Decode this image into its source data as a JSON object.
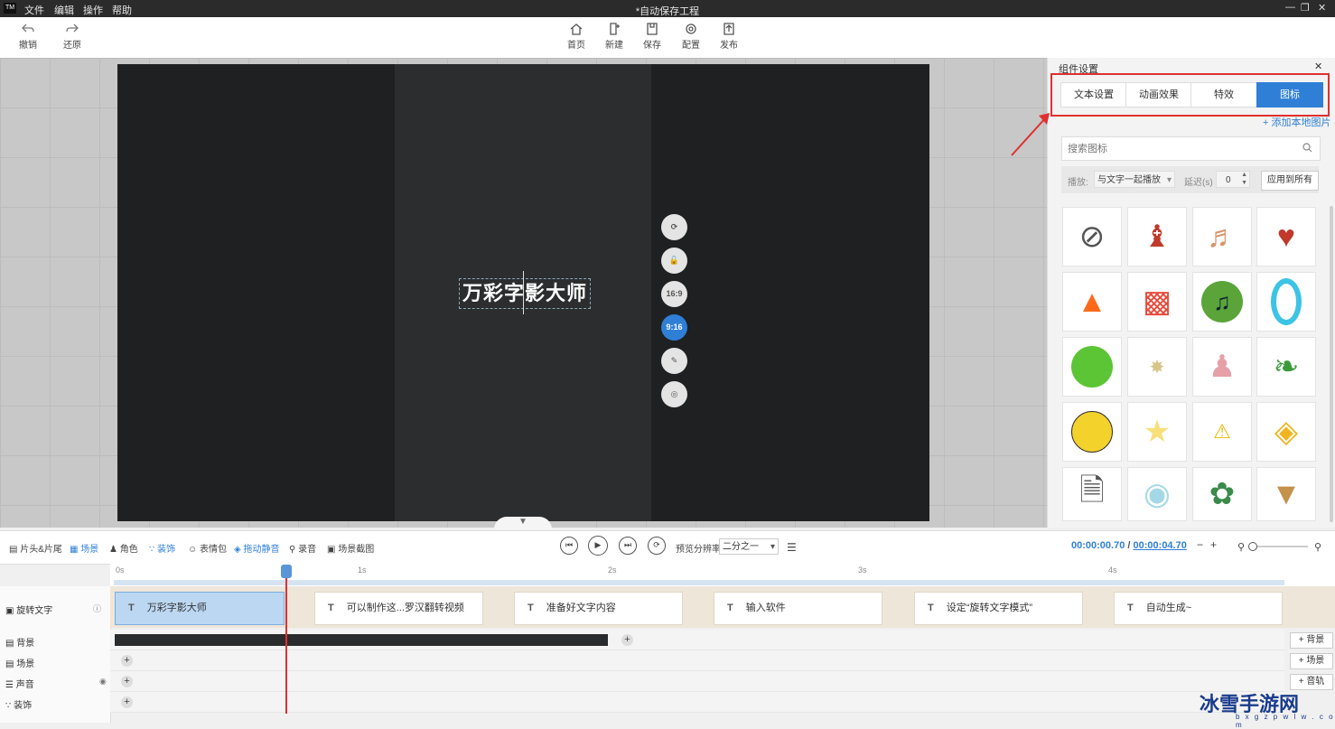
{
  "app": {
    "logo": "TM",
    "menu": [
      "文件",
      "编辑",
      "操作",
      "帮助"
    ],
    "title": "*自动保存工程",
    "window_controls": [
      "minimize",
      "restore",
      "close"
    ]
  },
  "toolbar": {
    "undo": "撤销",
    "redo": "还原",
    "home": "首页",
    "new": "新建",
    "save": "保存",
    "config": "配置",
    "publish": "发布"
  },
  "canvas": {
    "title_text": "万彩字影大师",
    "side_buttons": [
      {
        "name": "rotate-icon",
        "label": ""
      },
      {
        "name": "lock-icon",
        "label": ""
      },
      {
        "name": "ratio-16-9",
        "label": "16:9"
      },
      {
        "name": "ratio-9-16",
        "label": "9:16",
        "active": true
      },
      {
        "name": "edit-icon",
        "label": ""
      },
      {
        "name": "settings-icon",
        "label": ""
      }
    ]
  },
  "panel": {
    "title": "组件设置",
    "tabs": [
      {
        "label": "文本设置",
        "active": false
      },
      {
        "label": "动画效果",
        "active": false
      },
      {
        "label": "特效",
        "active": false
      },
      {
        "label": "图标",
        "active": true
      }
    ],
    "add_local": "添加本地图片",
    "search_placeholder": "搜索图标",
    "play_label": "播放:",
    "play_value": "与文字一起播放",
    "delay_label": "延迟(s)",
    "delay_value": "0",
    "apply_all": "应用到所有",
    "icons": [
      "no-icon",
      "scarecrow-icon",
      "dancer-icon",
      "playing-cards-icon",
      "fire-icon",
      "popcorn-icon",
      "music-note-icon",
      "blue-ring-icon",
      "green-apple-icon",
      "sparkle-icon",
      "girl-icon",
      "leaf-icon",
      "sunglasses-emoji-icon",
      "star-icon",
      "warning-sign-icon",
      "necklace-icon",
      "document-icon",
      "macaron-icon",
      "gift-hand-icon",
      "ice-cream-icon"
    ],
    "accent": "#2f7fd6",
    "highlight": "#e03030"
  },
  "controls": {
    "items": [
      "片头&片尾",
      "场景",
      "角色",
      "装饰",
      "表情包",
      "拖动静音",
      "录音",
      "场景截图"
    ],
    "resolution_label": "预览分辨率",
    "resolution_value": "二分之一",
    "time_current": "00:00:00.70",
    "time_sep": "/",
    "time_total": "00:00:04.70"
  },
  "timeline": {
    "ruler_marks": [
      "0s",
      "1s",
      "2s",
      "3s",
      "4s"
    ],
    "tracks": [
      "旋转文字",
      "背景",
      "场景",
      "声音",
      "装饰"
    ],
    "clips": [
      "万彩字影大师",
      "可以制作这...罗汉翻转视频",
      "准备好文字内容",
      "输入软件",
      "设定“旋转文字模式”",
      "自动生成~"
    ],
    "right_buttons": [
      "背景",
      "场景",
      "音轨"
    ]
  },
  "watermark": {
    "text": "冰雪手游网",
    "sub": "b x g z p w l w . c o m"
  }
}
